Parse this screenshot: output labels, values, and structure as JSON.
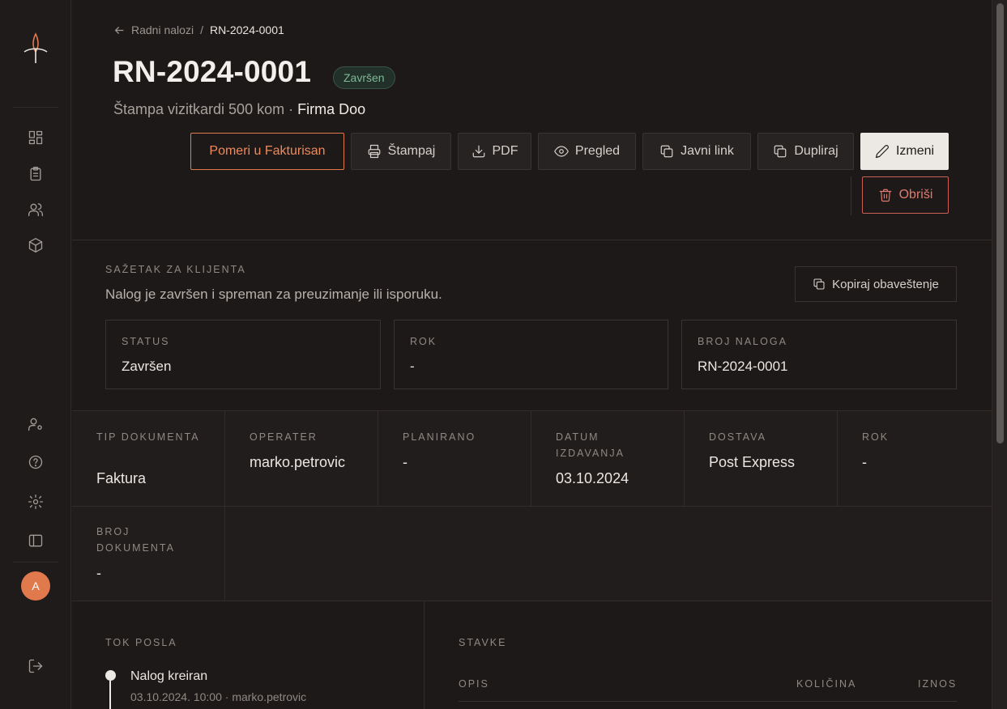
{
  "sidebar": {
    "items": [
      "dashboard",
      "orders",
      "clients",
      "products"
    ],
    "bottom_items": [
      "users-settings",
      "help",
      "settings",
      "toggle-sidebar"
    ],
    "avatar_initial": "A"
  },
  "breadcrumb": {
    "parent": "Radni nalozi",
    "separator": "/",
    "current": "RN-2024-0001"
  },
  "header": {
    "title": "RN-2024-0001",
    "status_badge": "Završen",
    "subtitle_prefix": "Štampa vizitkardi 500 kom ·",
    "client": "Firma Doo"
  },
  "actions": {
    "move": "Pomeri u Fakturisan",
    "print": "Štampaj",
    "pdf": "PDF",
    "preview": "Pregled",
    "public_link": "Javni link",
    "duplicate": "Dupliraj",
    "edit": "Izmeni",
    "delete": "Obriši"
  },
  "summary": {
    "label": "SAŽETAK ZA KLIJENTA",
    "text": "Nalog je završen i spreman za preuzimanje ili isporuku.",
    "copy_button": "Kopiraj obaveštenje",
    "cards": [
      {
        "label": "STATUS",
        "value": "Završen"
      },
      {
        "label": "ROK",
        "value": "-"
      },
      {
        "label": "BROJ NALOGA",
        "value": "RN-2024-0001"
      }
    ]
  },
  "meta": [
    {
      "label": "TIP DOKUMENTA",
      "value": "Faktura"
    },
    {
      "label": "OPERATER",
      "value": "marko.petrovic"
    },
    {
      "label": "PLANIRANO",
      "value": "-"
    },
    {
      "label": "DATUM IZDAVANJA",
      "value": "03.10.2024"
    },
    {
      "label": "DOSTAVA",
      "value": "Post Express"
    },
    {
      "label": "ROK",
      "value": "-"
    },
    {
      "label": "BROJ DOKUMENTA",
      "value": "-"
    }
  ],
  "workflow": {
    "label": "TOK POSLA",
    "events": [
      {
        "title": "Nalog kreiran",
        "meta": "03.10.2024. 10:00 · marko.petrovic"
      }
    ]
  },
  "items": {
    "label": "STAVKE",
    "columns": [
      "OPIS",
      "KOLIČINA",
      "IZNOS"
    ]
  },
  "colors": {
    "accent": "#e07a4d",
    "success": "#7fb796",
    "danger": "#e07a6f"
  }
}
